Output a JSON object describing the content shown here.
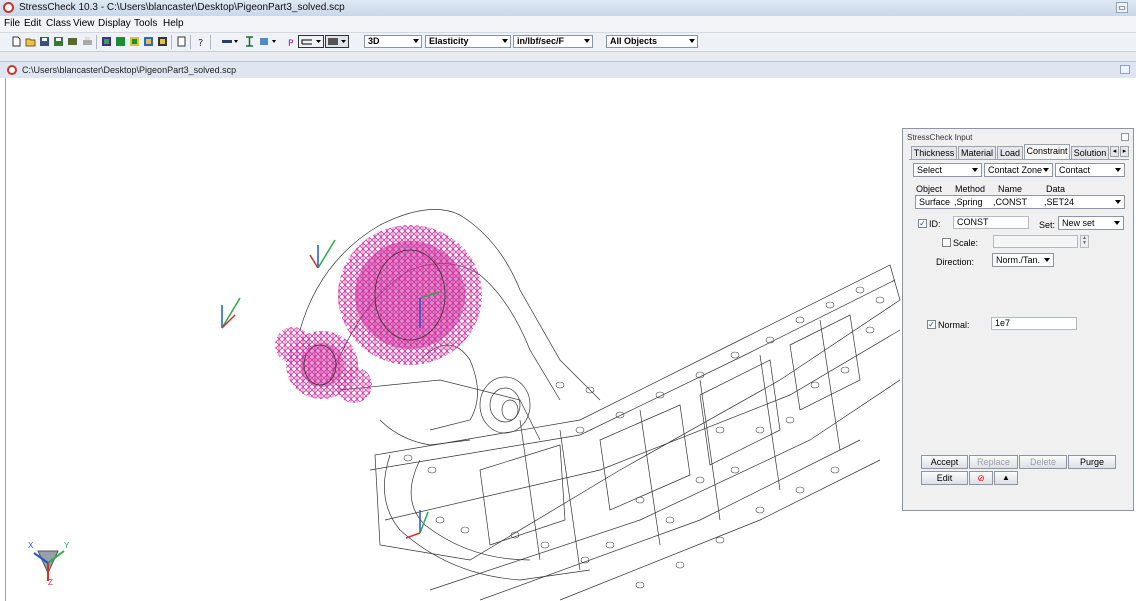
{
  "window": {
    "title": "StressCheck 10.3 - C:\\Users\\blancaster\\Desktop\\PigeonPart3_solved.scp"
  },
  "menu": [
    "File",
    "Edit",
    "Class",
    "View",
    "Display",
    "Tools",
    "Help"
  ],
  "toolbar": {
    "dimension": "3D",
    "analysis": "Elasticity",
    "units": "in/lbf/sec/F",
    "objects": "All Objects"
  },
  "document": {
    "title": "C:\\Users\\blancaster\\Desktop\\PigeonPart3_solved.scp"
  },
  "triad": {
    "x": "X",
    "y": "Y",
    "z": "Z"
  },
  "panel": {
    "title": "StressCheck Input",
    "tabs": [
      "Thickness",
      "Material",
      "Load",
      "Constraint",
      "Solution I"
    ],
    "active_tab": "Constraint",
    "select": "Select",
    "zone": "Contact Zone",
    "type": "Contact",
    "headers": {
      "object": "Object",
      "method": "Method",
      "name": "Name",
      "data": "Data"
    },
    "row": {
      "object": "Surface",
      "method": ",Spring",
      "name": ",CONST",
      "data": ",SET24"
    },
    "id_label": "ID:",
    "id_value": "CONST",
    "set_label": "Set:",
    "set_value": "New set",
    "scale_label": "Scale:",
    "scale_value": "",
    "direction_label": "Direction:",
    "direction_value": "Norm./Tan.",
    "normal_label": "Normal:",
    "normal_value": "1e7",
    "buttons": {
      "accept": "Accept",
      "replace": "Replace",
      "delete": "Delete",
      "purge": "Purge",
      "edit": "Edit"
    }
  },
  "colors": {
    "load_glyph": "#cc2b9c",
    "panel_bg": "#f0f0f0",
    "titlebar": "#c9d7ea"
  }
}
